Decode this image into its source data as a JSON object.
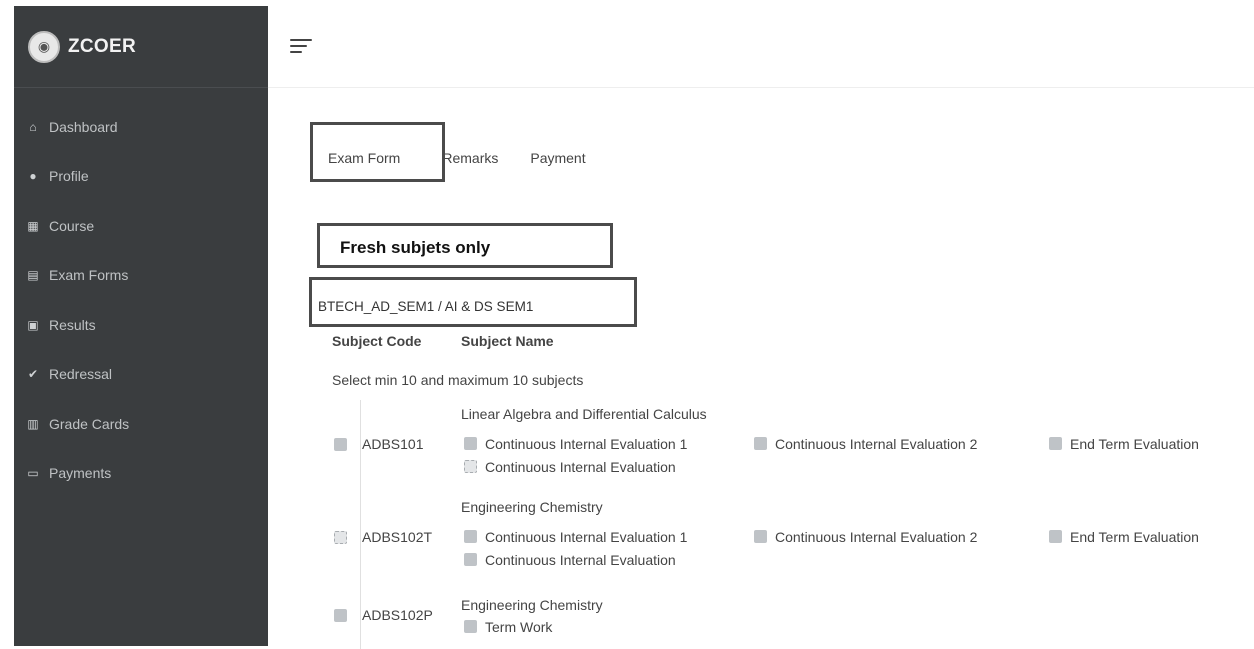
{
  "brand": {
    "name": "ZCOER"
  },
  "sidebar": {
    "items": [
      {
        "label": "Dashboard",
        "icon": "home-icon",
        "glyph": "⌂"
      },
      {
        "label": "Profile",
        "icon": "user-icon",
        "glyph": "●"
      },
      {
        "label": "Course",
        "icon": "book-icon",
        "glyph": "▦"
      },
      {
        "label": "Exam Forms",
        "icon": "form-icon",
        "glyph": "▤"
      },
      {
        "label": "Results",
        "icon": "results-icon",
        "glyph": "▣"
      },
      {
        "label": "Redressal",
        "icon": "check-icon",
        "glyph": "✔"
      },
      {
        "label": "Grade Cards",
        "icon": "card-icon",
        "glyph": "▥"
      },
      {
        "label": "Payments",
        "icon": "payment-icon",
        "glyph": "▭"
      }
    ]
  },
  "tabs": [
    {
      "label": "Exam Form"
    },
    {
      "label": "Remarks"
    },
    {
      "label": "Payment"
    }
  ],
  "fresh_label": "Fresh subjets only",
  "program_label": "BTECH_AD_SEM1 / AI & DS SEM1",
  "table": {
    "col_code": "Subject Code",
    "col_name": "Subject Name",
    "instruction": "Select min 10 and maximum 10 subjects"
  },
  "subjects": [
    {
      "code": "ADBS101",
      "name": "Linear Algebra and Differential Calculus",
      "options": [
        "Continuous Internal Evaluation 1",
        "Continuous Internal Evaluation 2",
        "End Term Evaluation",
        "Continuous Internal Evaluation"
      ]
    },
    {
      "code": "ADBS102T",
      "name": "Engineering Chemistry",
      "options": [
        "Continuous Internal Evaluation 1",
        "Continuous Internal Evaluation 2",
        "End Term Evaluation",
        "Continuous Internal Evaluation"
      ]
    },
    {
      "code": "ADBS102P",
      "name": "Engineering Chemistry",
      "options": [
        "Term Work"
      ]
    }
  ]
}
